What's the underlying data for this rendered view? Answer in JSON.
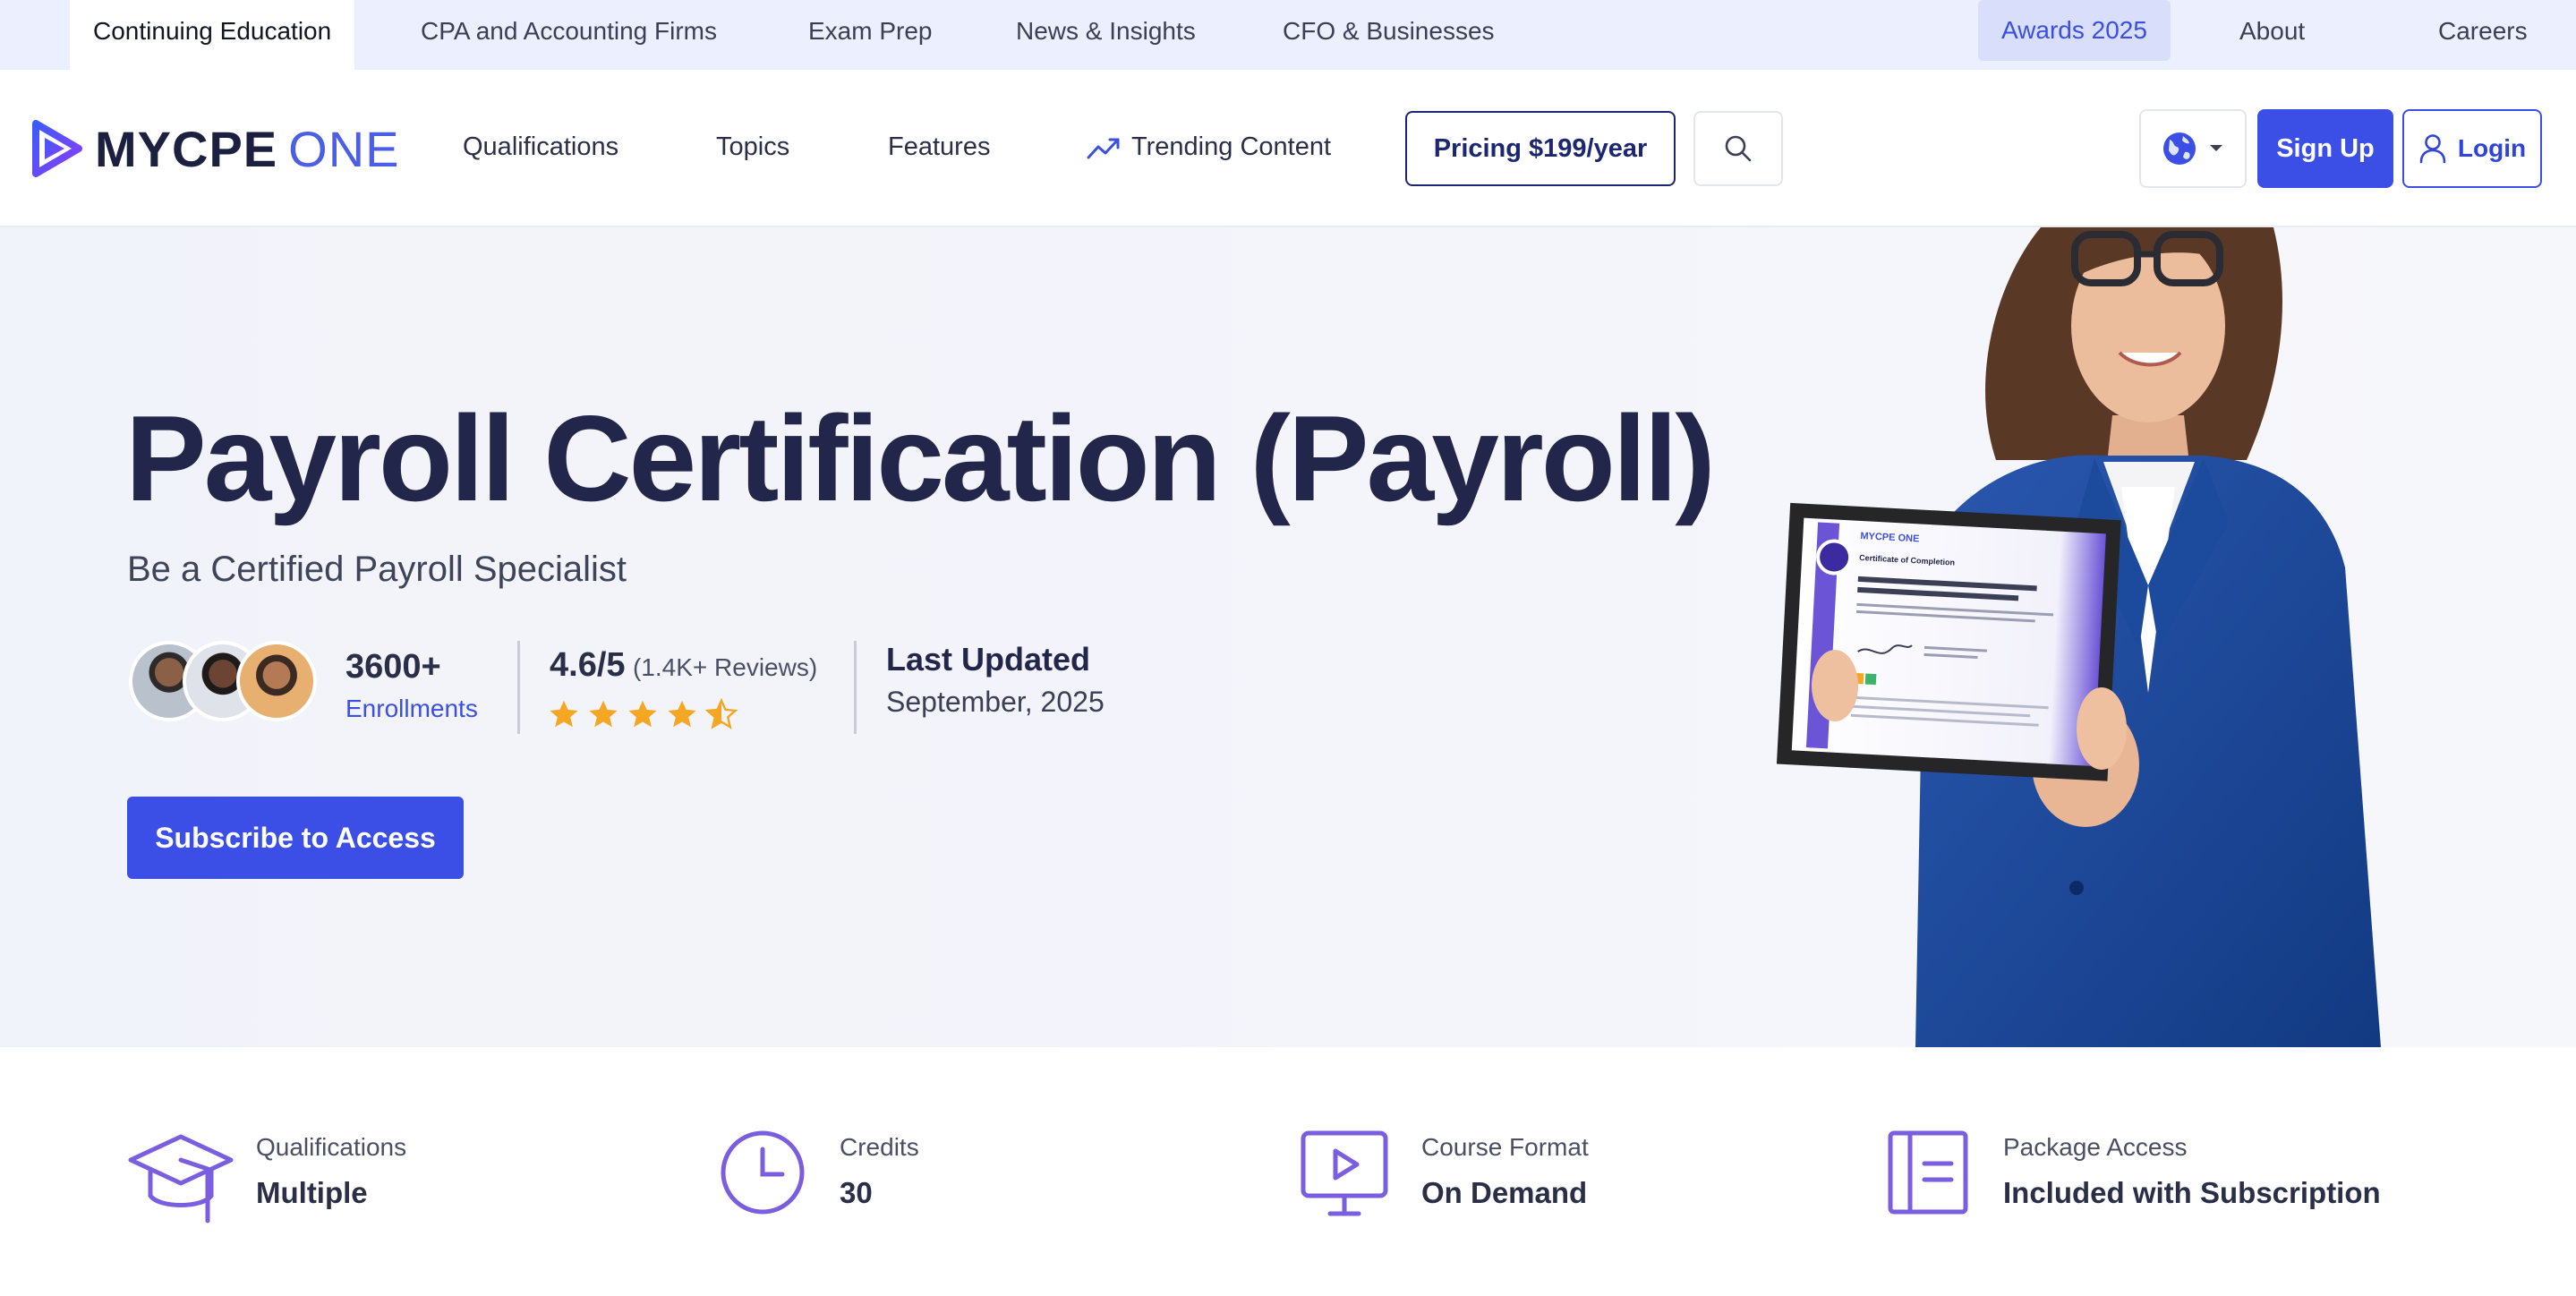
{
  "topbar": {
    "items": [
      {
        "label": "Continuing Education"
      },
      {
        "label": "CPA and Accounting Firms"
      },
      {
        "label": "Exam Prep"
      },
      {
        "label": "News & Insights"
      },
      {
        "label": "CFO & Businesses"
      }
    ],
    "right": [
      {
        "label": "Awards 2025"
      },
      {
        "label": "About"
      },
      {
        "label": "Careers"
      }
    ]
  },
  "brand": {
    "primary": "MYCPE",
    "secondary": "ONE",
    "accent": "#3b4fe6",
    "logo_gradient": [
      "#3b5bfd",
      "#8b3dff"
    ]
  },
  "nav": {
    "links": [
      {
        "label": "Qualifications"
      },
      {
        "label": "Topics"
      },
      {
        "label": "Features"
      },
      {
        "label": "Trending Content",
        "icon": "trending-up-icon"
      }
    ],
    "pricing_label": "Pricing $199/year",
    "search_icon": "search-icon",
    "globe_icon": "globe-icon",
    "signup_label": "Sign Up",
    "login_label": "Login"
  },
  "hero": {
    "title": "Payroll Certification (Payroll)",
    "subtitle": "Be a Certified Payroll Specialist",
    "enrollments": {
      "count": "3600+",
      "label": "Enrollments"
    },
    "rating": {
      "score": "4.6/5",
      "reviews": "(1.4K+ Reviews)",
      "stars": 4.5
    },
    "updated": {
      "label": "Last Updated",
      "value": "September, 2025"
    },
    "cta_label": "Subscribe to Access",
    "certificate": {
      "brand": "MYCPE ONE",
      "heading": "Certificate of Completion"
    }
  },
  "features": [
    {
      "icon": "graduation-cap-icon",
      "label": "Qualifications",
      "value": "Multiple"
    },
    {
      "icon": "clock-icon",
      "label": "Credits",
      "value": "30"
    },
    {
      "icon": "video-play-icon",
      "label": "Course Format",
      "value": "On Demand"
    },
    {
      "icon": "document-icon",
      "label": "Package Access",
      "value": "Included with Subscription"
    }
  ],
  "colors": {
    "star": "#f5a623",
    "feature_icon": "#7a5ee0",
    "hero_bg": "#f2f4fa",
    "topbar_bg": "#eceffd"
  }
}
